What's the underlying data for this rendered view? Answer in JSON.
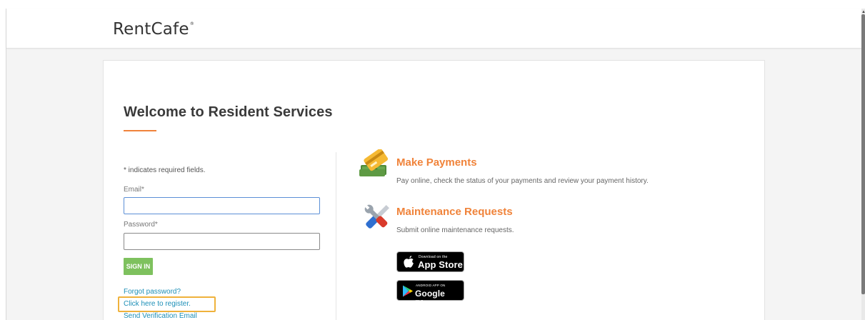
{
  "header": {
    "logo_text": "RentCafe",
    "logo_mark": "®"
  },
  "login": {
    "title": "Welcome to Resident Services",
    "required_note": "* indicates required fields.",
    "email_label": "Email*",
    "email_value": "",
    "password_label": "Password*",
    "password_value": "",
    "signin_label": "SIGN IN",
    "forgot_link": "Forgot password?",
    "register_link": "Click here to register.",
    "verify_link": "Send Verification Email"
  },
  "features": [
    {
      "icon": "payment-card-cash-icon",
      "title": "Make Payments",
      "description": "Pay online, check the status of your payments and review your payment history."
    },
    {
      "icon": "wrench-screwdriver-icon",
      "title": "Maintenance Requests",
      "description": "Submit online maintenance requests."
    }
  ],
  "badges": {
    "appstore_small": "Download on the",
    "appstore_big": "App Store",
    "googleplay_small": "ANDROID APP ON",
    "googleplay_big": "Google Play"
  },
  "colors": {
    "accent": "#f0833a",
    "button": "#7ec15e",
    "link": "#1d8fb7",
    "highlight": "#efb23c"
  }
}
